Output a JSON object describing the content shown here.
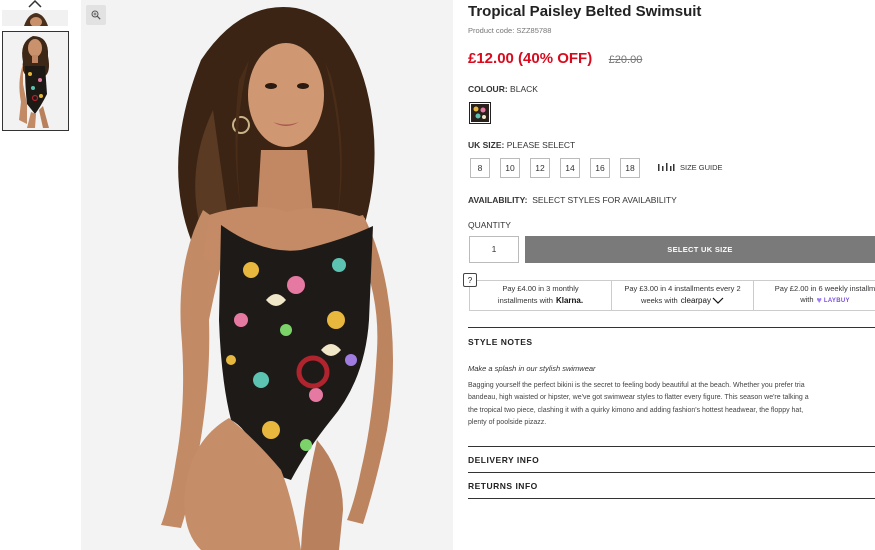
{
  "product": {
    "title": "Tropical Paisley Belted Swimsuit",
    "code": "Product code: SZZ85788",
    "price_now": "£12.00 (40% OFF)",
    "price_was": "£20.00"
  },
  "colour": {
    "label": "COLOUR:",
    "value": "BLACK"
  },
  "size": {
    "label": "UK SIZE:",
    "value": "PLEASE SELECT",
    "options": [
      "8",
      "10",
      "12",
      "14",
      "16",
      "18"
    ],
    "guide_label": "SIZE GUIDE"
  },
  "availability": {
    "label": "AVAILABILITY:",
    "value": "SELECT STYLES FOR AVAILABILITY"
  },
  "quantity": {
    "label": "QUANTITY",
    "value": "1"
  },
  "add_button_label": "SELECT UK SIZE",
  "help_label": "?",
  "payments": [
    {
      "line1": "Pay £4.00 in 3 monthly",
      "line2": "installments with",
      "brand": "Klarna."
    },
    {
      "line1": "Pay £3.00 in 4 installments every 2",
      "line2": "weeks with",
      "brand": "clearpay"
    },
    {
      "line1": "Pay £2.00 in 6 weekly installm",
      "line2": "with",
      "brand": "LAYBUY"
    }
  ],
  "style_notes": {
    "title": "STYLE NOTES",
    "tagline": "Make a splash in our stylish swimwear",
    "description": [
      "Bagging yourself the perfect bikini is the secret to feeling body beautiful at the beach. Whether you prefer tria",
      "bandeau, high waisted or hipster, we've got swimwear styles to flatter every figure. This season we're talking a",
      "the tropical two piece, clashing it with a quirky kimono and adding fashion's hottest headwear, the floppy hat,",
      "plenty of poolside pizazz."
    ]
  },
  "delivery_title": "DELIVERY INFO",
  "returns_title": "RETURNS INFO",
  "icons": {
    "thumb_scroll_up": "chevron-up-icon",
    "zoom": "zoom-in-icon",
    "size_guide": "ruler-icon",
    "laybuy": "heart-icon"
  },
  "colors": {
    "sale_price": "#d80b1e",
    "button_bg": "#7a7a7a",
    "laybuy": "#7a4fe0"
  }
}
